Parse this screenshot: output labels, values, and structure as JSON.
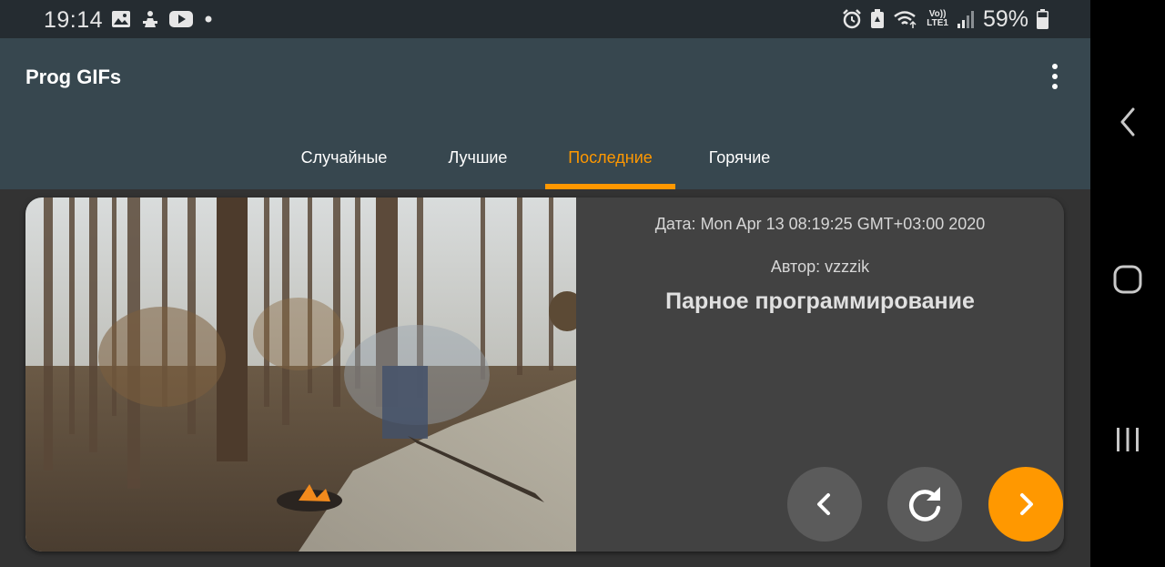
{
  "status_bar": {
    "time": "19:14",
    "battery": "59%",
    "left_icons": [
      "gallery-icon",
      "app-notification-icon",
      "youtube-icon",
      "dot-icon"
    ],
    "right_icons": [
      "alarm-icon",
      "battery-saver-icon",
      "wifi-icon",
      "volte-lte-icon",
      "signal-icon",
      "battery-icon"
    ],
    "volte_label": "Vo))",
    "lte_label": "LTE1"
  },
  "toolbar": {
    "title": "Prog GIFs",
    "menu_icon": "more-vert-icon"
  },
  "tabs": [
    {
      "label": "Случайные",
      "active": false
    },
    {
      "label": "Лучшие",
      "active": false
    },
    {
      "label": "Последние",
      "active": true
    },
    {
      "label": "Горячие",
      "active": false
    }
  ],
  "card": {
    "date": "Дата: Mon Apr 13 08:19:25 GMT+03:00 2020",
    "author": "Автор: vzzzik",
    "title": "Парное программирование"
  },
  "buttons": {
    "prev_icon": "chevron-left-icon",
    "reload_icon": "reload-icon",
    "next_icon": "chevron-right-icon"
  },
  "nav_bar": [
    "back-icon",
    "home-icon",
    "recents-icon"
  ],
  "colors": {
    "accent": "#ff9800",
    "toolbar": "#37474f",
    "status_bar": "#252c31",
    "background": "#333333",
    "card": "#424242"
  }
}
